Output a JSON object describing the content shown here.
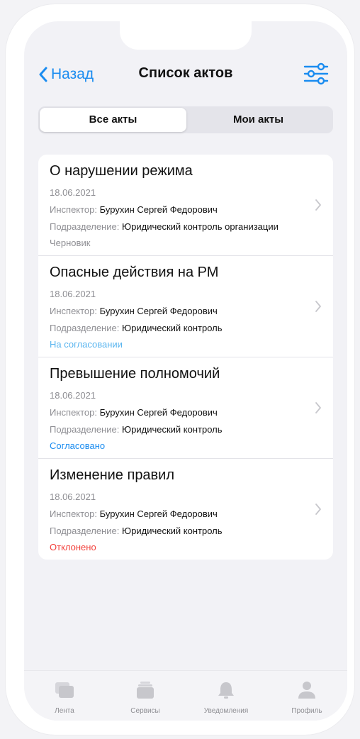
{
  "nav": {
    "back_label": "Назад",
    "title": "Список актов"
  },
  "segment": {
    "all_label": "Все акты",
    "mine_label": "Мои акты"
  },
  "acts": [
    {
      "title": "О нарушении режима",
      "date": "18.06.2021",
      "inspector_label": "Инспектор:",
      "inspector": "Бурухин Сергей Федорович",
      "division_label": "Подразделение:",
      "division": "Юридический контроль организации",
      "status": "Черновик",
      "status_color": "#8e8e93"
    },
    {
      "title": "Опасные действия на РМ",
      "date": "18.06.2021",
      "inspector_label": "Инспектор:",
      "inspector": "Бурухин Сергей Федорович",
      "division_label": "Подразделение:",
      "division": "Юридический контроль",
      "status": "На согласовании",
      "status_color": "#5ab5ef"
    },
    {
      "title": "Превышение полномочий",
      "date": "18.06.2021",
      "inspector_label": "Инспектор:",
      "inspector": "Бурухин Сергей Федорович",
      "division_label": "Подразделение:",
      "division": "Юридический контроль",
      "status": "Согласовано",
      "status_color": "#1a8cf0"
    },
    {
      "title": "Изменение правил",
      "date": "18.06.2021",
      "inspector_label": "Инспектор:",
      "inspector": "Бурухин Сергей Федорович",
      "division_label": "Подразделение:",
      "division": "Юридический контроль",
      "status": "Отклонено",
      "status_color": "#f2403b"
    }
  ],
  "tabbar": {
    "feed_label": "Лента",
    "services_label": "Сервисы",
    "notifications_label": "Уведомления",
    "profile_label": "Профиль"
  },
  "colors": {
    "accent": "#1a8cf0",
    "tab_icon": "#c7c7cc"
  }
}
